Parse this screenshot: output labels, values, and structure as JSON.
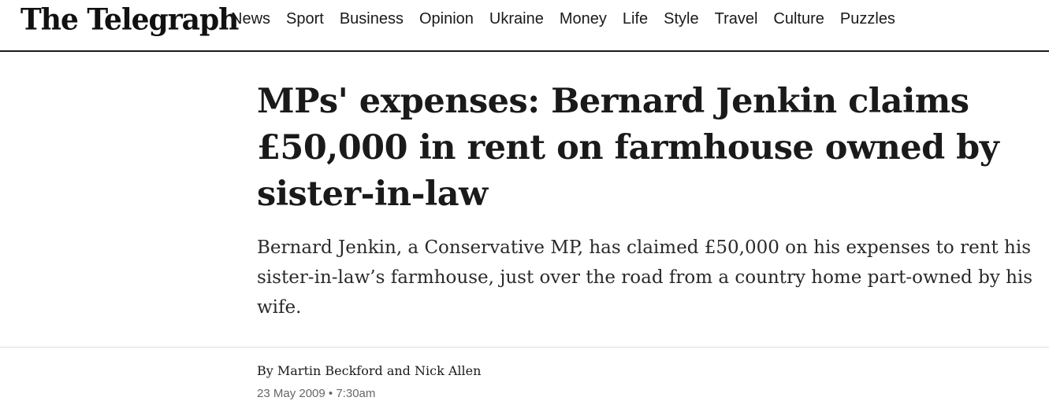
{
  "header": {
    "logo_text": "The Telegraph",
    "nav": [
      {
        "label": "News"
      },
      {
        "label": "Sport"
      },
      {
        "label": "Business"
      },
      {
        "label": "Opinion"
      },
      {
        "label": "Ukraine"
      },
      {
        "label": "Money"
      },
      {
        "label": "Life"
      },
      {
        "label": "Style"
      },
      {
        "label": "Travel"
      },
      {
        "label": "Culture"
      },
      {
        "label": "Puzzles"
      }
    ]
  },
  "article": {
    "headline": "MPs' expenses: Bernard Jenkin claims £50,000 in rent on farmhouse owned by sister-in-law",
    "standfirst": "Bernard Jenkin, a Conservative MP, has claimed £50,000 on his expenses to rent his sister-in-law’s farmhouse, just over the road from a country home part-owned by his wife.",
    "byline_prefix": "By",
    "author_1": "Martin Beckford",
    "byline_joiner": "and",
    "author_2": "Nick Allen",
    "date": "23 May 2009",
    "date_separator": "•",
    "time": "7:30am"
  }
}
